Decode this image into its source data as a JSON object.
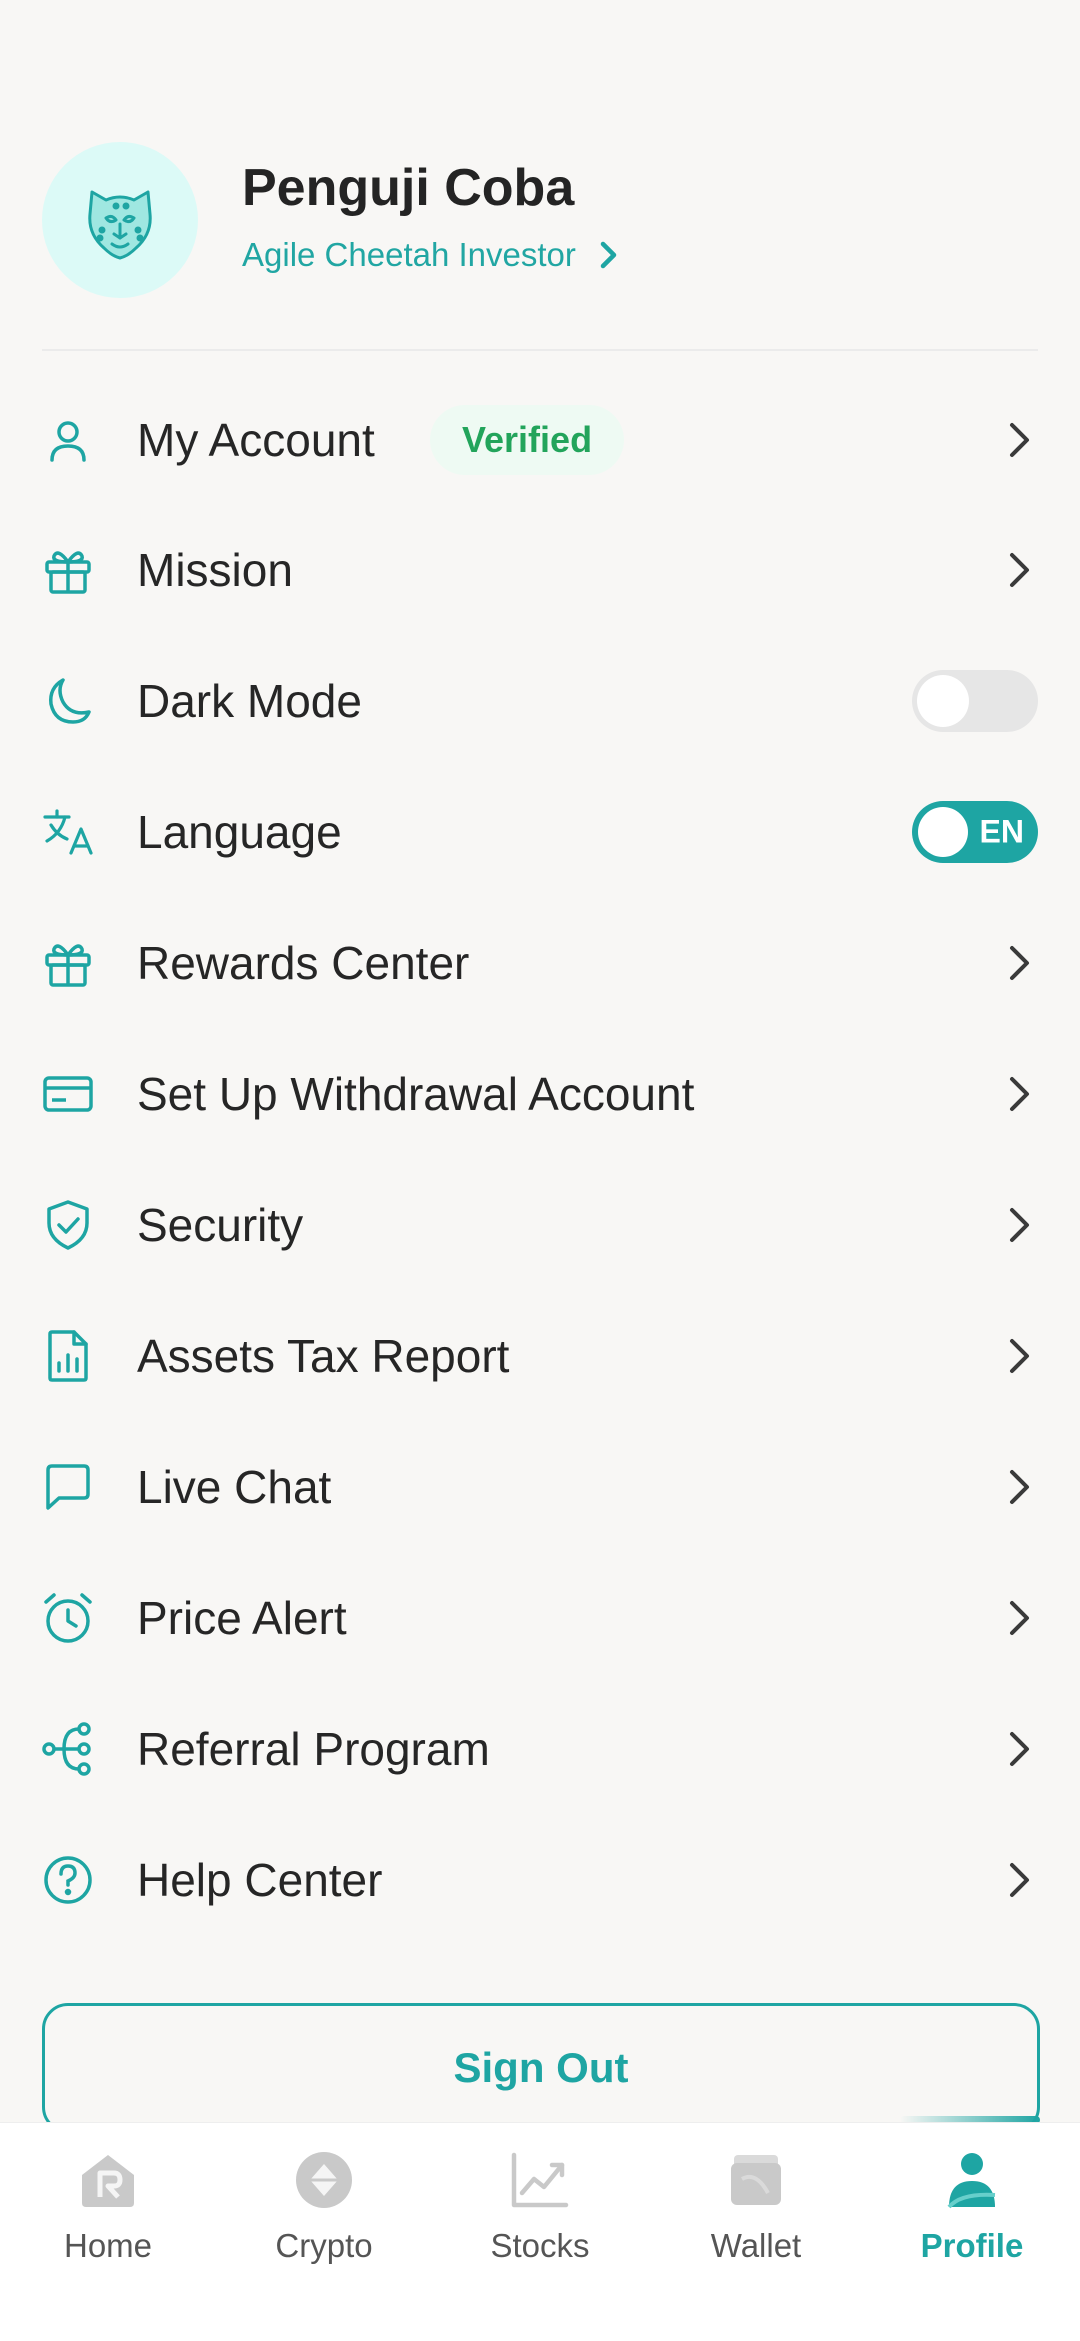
{
  "profile": {
    "name": "Penguji Coba",
    "tier": "Agile Cheetah Investor"
  },
  "menu": {
    "account": {
      "label": "My Account",
      "badge": "Verified"
    },
    "mission": {
      "label": "Mission"
    },
    "dark_mode": {
      "label": "Dark Mode",
      "enabled": false
    },
    "language": {
      "label": "Language",
      "value": "EN"
    },
    "rewards": {
      "label": "Rewards Center"
    },
    "withdrawal": {
      "label": "Set Up Withdrawal Account"
    },
    "security": {
      "label": "Security"
    },
    "tax": {
      "label": "Assets Tax Report"
    },
    "chat": {
      "label": "Live Chat"
    },
    "price_alert": {
      "label": "Price Alert"
    },
    "referral": {
      "label": "Referral Program"
    },
    "help": {
      "label": "Help Center"
    }
  },
  "sign_out": "Sign Out",
  "nav": {
    "home": "Home",
    "crypto": "Crypto",
    "stocks": "Stocks",
    "wallet": "Wallet",
    "profile": "Profile",
    "active": "profile"
  },
  "colors": {
    "accent": "#1ea5a3",
    "verified": "#22a45b",
    "background": "#f8f7f5"
  }
}
